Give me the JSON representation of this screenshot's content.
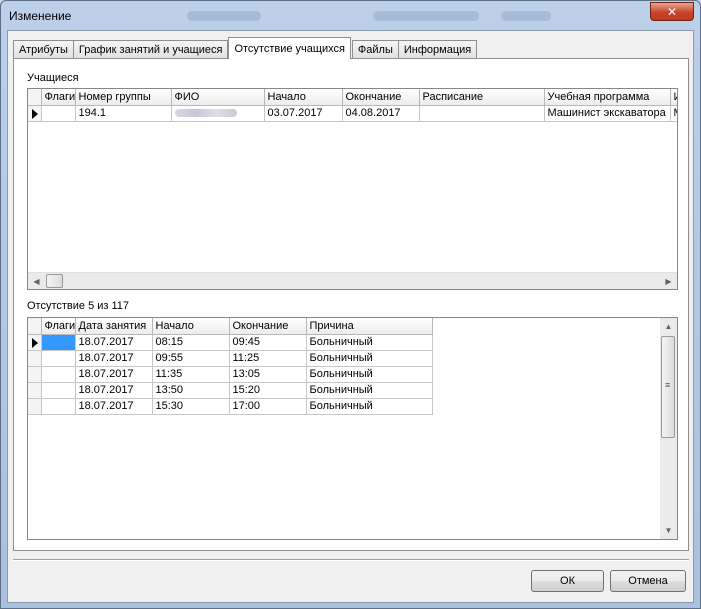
{
  "window": {
    "title": "Изменение",
    "close_glyph": "✕"
  },
  "tabs": [
    {
      "label": "Атрибуты",
      "active": false
    },
    {
      "label": "График занятий и учащиеся",
      "active": false
    },
    {
      "label": "Отсутствие учащихся",
      "active": true
    },
    {
      "label": "Файлы",
      "active": false
    },
    {
      "label": "Информация",
      "active": false
    }
  ],
  "students": {
    "label": "Учащиеся",
    "columns": [
      "Флаги",
      "Номер группы",
      "ФИО",
      "Начало",
      "Окончание",
      "Расписание",
      "Учебная программа",
      "И"
    ],
    "rows": [
      {
        "flags": "",
        "group": "194.1",
        "start": "03.07.2017",
        "end": "04.08.2017",
        "schedule": "",
        "program": "Машинист экскаватора",
        "extra": "М"
      }
    ]
  },
  "absence": {
    "label": "Отсутствие 5 из 117",
    "columns": [
      "Флаги",
      "Дата занятия",
      "Начало",
      "Окончание",
      "Причина"
    ],
    "rows": [
      {
        "flags": "",
        "date": "18.07.2017",
        "start": "08:15",
        "end": "09:45",
        "reason": "Больничный"
      },
      {
        "flags": "",
        "date": "18.07.2017",
        "start": "09:55",
        "end": "11:25",
        "reason": "Больничный"
      },
      {
        "flags": "",
        "date": "18.07.2017",
        "start": "11:35",
        "end": "13:05",
        "reason": "Больничный"
      },
      {
        "flags": "",
        "date": "18.07.2017",
        "start": "13:50",
        "end": "15:20",
        "reason": "Больничный"
      },
      {
        "flags": "",
        "date": "18.07.2017",
        "start": "15:30",
        "end": "17:00",
        "reason": "Больничный"
      }
    ]
  },
  "buttons": {
    "ok": "ОК",
    "cancel": "Отмена"
  },
  "icons": {
    "row_marker": "row-pointer-icon",
    "arrow_left": "◀",
    "arrow_right": "▶",
    "arrow_up": "▲",
    "arrow_down": "▼",
    "grip": "≡"
  },
  "colors": {
    "selection": "#3399ff",
    "close_button": "#c9442a"
  }
}
